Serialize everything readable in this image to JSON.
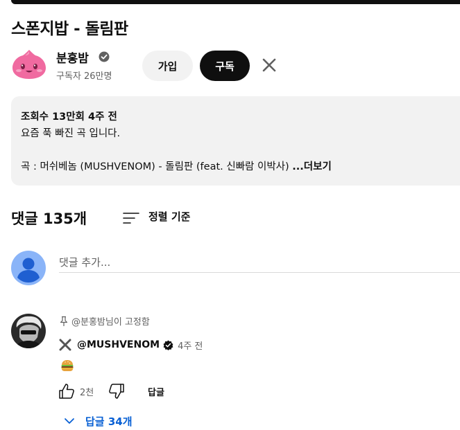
{
  "video": {
    "title": "스폰지밥 - 돌림판"
  },
  "channel": {
    "name": "분홍밤",
    "subscribers": "구독자 26만명",
    "join_label": "가입",
    "subscribe_label": "구독"
  },
  "description": {
    "meta": "조회수 13만회  4주 전",
    "line1": "요즘 푹 빠진 곡 입니다.",
    "line2": "곡 : 머쉬베놈 (MUSHVENOM) - 돌림판 (feat. 신빠람 이박사) ",
    "more": "...더보기"
  },
  "comments": {
    "count_label": "댓글 135개",
    "sort_label": "정렬 기준",
    "add_placeholder": "댓글 추가...",
    "items": [
      {
        "pinned_by": "@분홍밤님이 고정함",
        "author": "@MUSHVENOM",
        "time": "4주 전",
        "text_emoji": "hamburger",
        "likes": "2천",
        "reply_label": "답글",
        "replies_label": "답글 34개"
      }
    ]
  },
  "colors": {
    "accent_blue": "#065fd4",
    "subscribe_bg": "#0f0f0f",
    "join_bg": "#f2f2f2",
    "description_bg": "#f2f2f2",
    "avatar_pink": "#f06aa0",
    "my_avatar_blue": "#8ab4f8"
  },
  "icons": {
    "verified": "verified-check-icon",
    "close": "close-icon",
    "sort": "sort-icon",
    "pin": "pin-icon",
    "creator_mark": "x-mark-icon",
    "like": "thumbs-up-icon",
    "dislike": "thumbs-down-icon",
    "expand": "chevron-down-icon"
  }
}
